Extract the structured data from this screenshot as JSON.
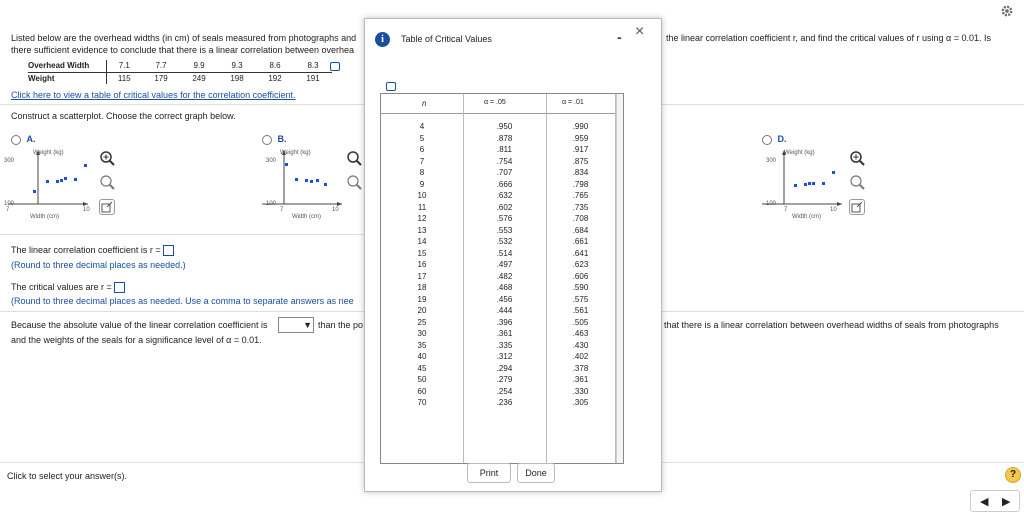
{
  "problem": {
    "line1": "Listed below are the overhead widths (in cm) of seals measured from photographs and",
    "line1_right": "the linear correlation coefficient r, and find the critical values of r using α = 0.01. Is",
    "line2": "there sufficient evidence to conclude that there is a linear correlation between overhea",
    "table": {
      "row1_label": "Overhead Width",
      "row2_label": "Weight",
      "widths": [
        "7.1",
        "7.7",
        "9.9",
        "9.3",
        "8.6",
        "8.3"
      ],
      "weights": [
        "115",
        "179",
        "249",
        "198",
        "192",
        "191"
      ]
    },
    "link": "Click here to view a table of critical values for the correlation coefficient.",
    "scatter_prompt": "Construct a scatterplot. Choose the correct graph below.",
    "options": [
      {
        "letter": "A.",
        "ylabel": "Weight (kg)",
        "xlabel": "Width (cm)",
        "y_top": "300",
        "y_bottom": "100",
        "x_left": "7",
        "x_right": "10"
      },
      {
        "letter": "B.",
        "ylabel": "Weight (kg)",
        "xlabel": "Width (cm)",
        "y_top": "300",
        "y_bottom": "100",
        "x_left": "7",
        "x_right": "10"
      },
      {
        "letter": "D.",
        "ylabel": "Weight (kg)",
        "xlabel": "Width (cm)",
        "y_top": "300",
        "y_bottom": "100",
        "x_left": "7",
        "x_right": "10"
      }
    ],
    "r_prompt": "The linear correlation coefficient is r =",
    "round_note": "(Round to three decimal places as needed.)",
    "crit_prompt": "The critical values are r =",
    "crit_note": "(Round to three decimal places as needed. Use a comma to separate answers as nee",
    "because_text": "Because the absolute value of the linear correlation coefficient is",
    "because_after": "than the po",
    "because_right": "that there is a linear correlation between overhead widths of seals from photographs",
    "because_line2": "and the weights of the seals for a significance level of α = 0.01.",
    "footer": "Click to select your answer(s)."
  },
  "modal": {
    "title": "Table of Critical Values",
    "minimize": "-",
    "close": "×",
    "col_n": "n",
    "col_05": "α = .05",
    "col_01": "α = .01",
    "rows": [
      [
        "4",
        ".950",
        ".990"
      ],
      [
        "5",
        ".878",
        ".959"
      ],
      [
        "6",
        ".811",
        ".917"
      ],
      [
        "7",
        ".754",
        ".875"
      ],
      [
        "8",
        ".707",
        ".834"
      ],
      [
        "9",
        ".666",
        ".798"
      ],
      [
        "10",
        ".632",
        ".765"
      ],
      [
        "11",
        ".602",
        ".735"
      ],
      [
        "12",
        ".576",
        ".708"
      ],
      [
        "13",
        ".553",
        ".684"
      ],
      [
        "14",
        ".532",
        ".661"
      ],
      [
        "15",
        ".514",
        ".641"
      ],
      [
        "16",
        ".497",
        ".623"
      ],
      [
        "17",
        ".482",
        ".606"
      ],
      [
        "18",
        ".468",
        ".590"
      ],
      [
        "19",
        ".456",
        ".575"
      ],
      [
        "20",
        ".444",
        ".561"
      ],
      [
        "25",
        ".396",
        ".505"
      ],
      [
        "30",
        ".361",
        ".463"
      ],
      [
        "35",
        ".335",
        ".430"
      ],
      [
        "40",
        ".312",
        ".402"
      ],
      [
        "45",
        ".294",
        ".378"
      ],
      [
        "50",
        ".279",
        ".361"
      ],
      [
        "60",
        ".254",
        ".330"
      ],
      [
        "70",
        ".236",
        ".305"
      ]
    ],
    "print": "Print",
    "done": "Done"
  },
  "icons": {
    "settings": "gear-icon",
    "help": "help-icon",
    "nav_prev": "triangle-left-icon",
    "nav_next": "triangle-right-icon"
  },
  "help_label": "?",
  "colors": {
    "link": "#1a4fa0",
    "info": "#1a4fa0",
    "help": "#f2c94c",
    "dots": "#1f4fd6"
  }
}
